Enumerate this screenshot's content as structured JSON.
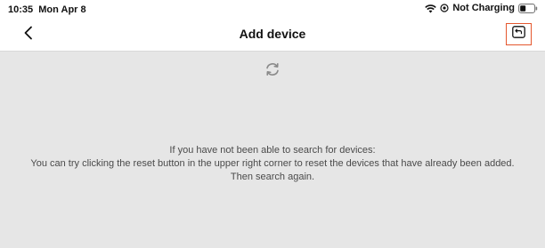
{
  "status_bar": {
    "time": "10:35",
    "date": "Mon Apr 8",
    "battery_text": "Not Charging",
    "icons": [
      "wifi-icon",
      "location-icon",
      "battery-icon"
    ]
  },
  "nav": {
    "title": "Add device",
    "back_icon": "chevron-left-icon",
    "reset_icon": "reset-icon",
    "reset_highlight_color": "#e4572e"
  },
  "content": {
    "refresh_icon": "refresh-icon",
    "help_lines": [
      "If you have not been able to search for devices:",
      "You can try clicking the reset button in the upper right corner to reset the devices that have already been added.",
      "Then search again."
    ]
  }
}
